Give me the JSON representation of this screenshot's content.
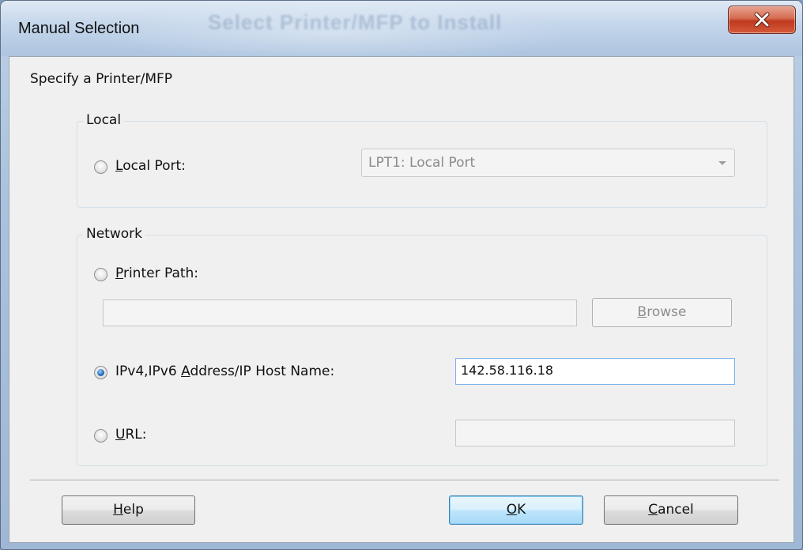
{
  "window": {
    "title": "Manual Selection",
    "background_title": "Select Printer/MFP to Install",
    "close_icon": "close-icon"
  },
  "heading": "Specify a Printer/MFP",
  "local_group": {
    "label": "Local",
    "local_port": {
      "label_underlined": "L",
      "label_rest": "ocal Port:",
      "selected": false,
      "combo_value": "LPT1:  Local Port"
    }
  },
  "network_group": {
    "label": "Network",
    "printer_path": {
      "label_underlined": "P",
      "label_rest": "rinter Path:",
      "selected": false,
      "value": "",
      "browse_underlined": "B",
      "browse_rest": "rowse"
    },
    "ip_address": {
      "label_before": "IPv4,IPv6 ",
      "label_underlined": "A",
      "label_rest": "ddress/IP Host Name:",
      "selected": true,
      "value": "142.58.116.18"
    },
    "url": {
      "label_underlined": "U",
      "label_rest": "RL:",
      "selected": false,
      "value": ""
    }
  },
  "buttons": {
    "help_underlined": "H",
    "help_rest": "elp",
    "ok_underlined": "O",
    "ok_rest": "K",
    "cancel_underlined": "C",
    "cancel_rest": "ancel"
  },
  "colors": {
    "accent": "#3c7fb1",
    "close_button": "#c0391e",
    "dialog_background": "#f0f0f0"
  }
}
